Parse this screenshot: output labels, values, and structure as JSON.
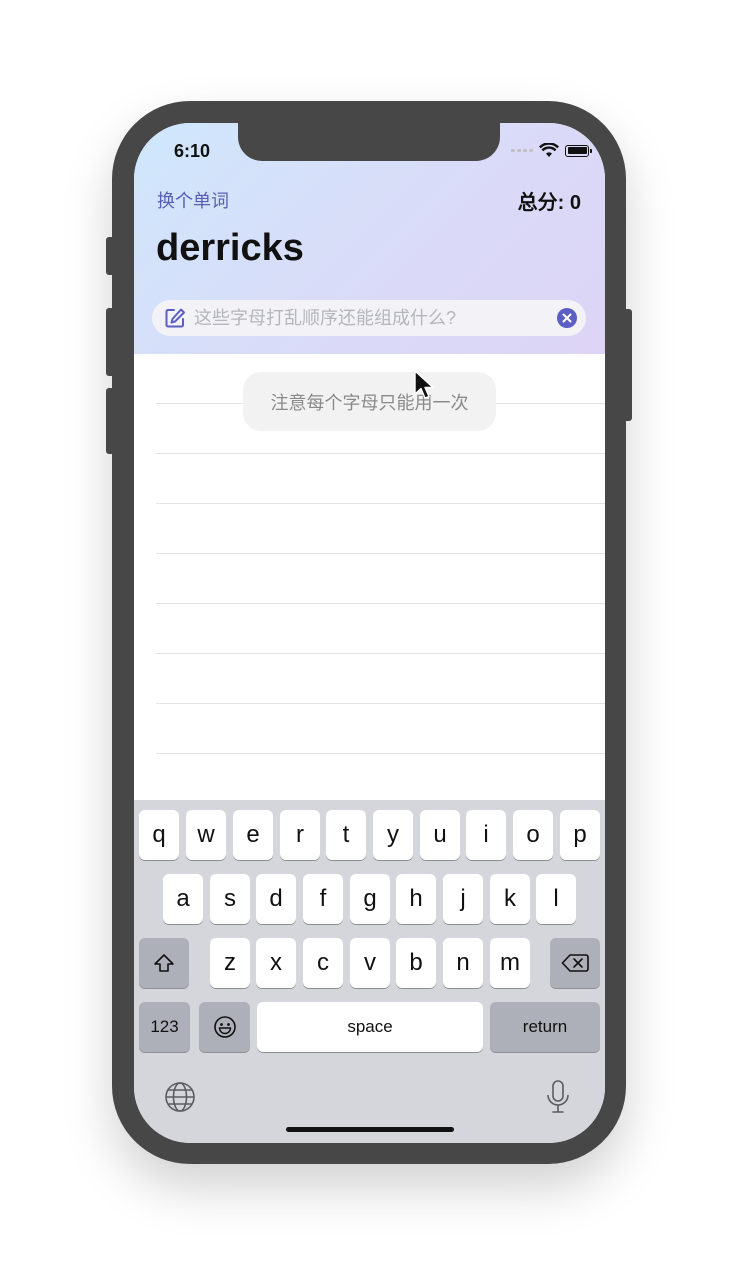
{
  "status_bar": {
    "time": "6:10"
  },
  "header": {
    "change_word_label": "换个单词",
    "score_label": "总分: 0",
    "current_word": "derricks"
  },
  "search": {
    "placeholder": "这些字母打乱顺序还能组成什么?",
    "value": ""
  },
  "toast": {
    "message": "注意每个字母只能用一次"
  },
  "keyboard": {
    "row1": [
      "q",
      "w",
      "e",
      "r",
      "t",
      "y",
      "u",
      "i",
      "o",
      "p"
    ],
    "row2": [
      "a",
      "s",
      "d",
      "f",
      "g",
      "h",
      "j",
      "k",
      "l"
    ],
    "row3": [
      "z",
      "x",
      "c",
      "v",
      "b",
      "n",
      "m"
    ],
    "numbers_label": "123",
    "space_label": "space",
    "return_label": "return"
  },
  "icons": {
    "edit": "edit-icon",
    "clear": "clear-icon",
    "shift": "shift-icon",
    "backspace": "backspace-icon",
    "emoji": "emoji-icon",
    "globe": "globe-icon",
    "mic": "microphone-icon",
    "wifi": "wifi-icon",
    "battery": "battery-icon",
    "cursor": "mouse-cursor-icon"
  },
  "colors": {
    "accent": "#5b5fc4",
    "link": "#5a5db3",
    "header_gradient_start": "#cfe7fc",
    "header_gradient_end": "#ddd4f6"
  }
}
